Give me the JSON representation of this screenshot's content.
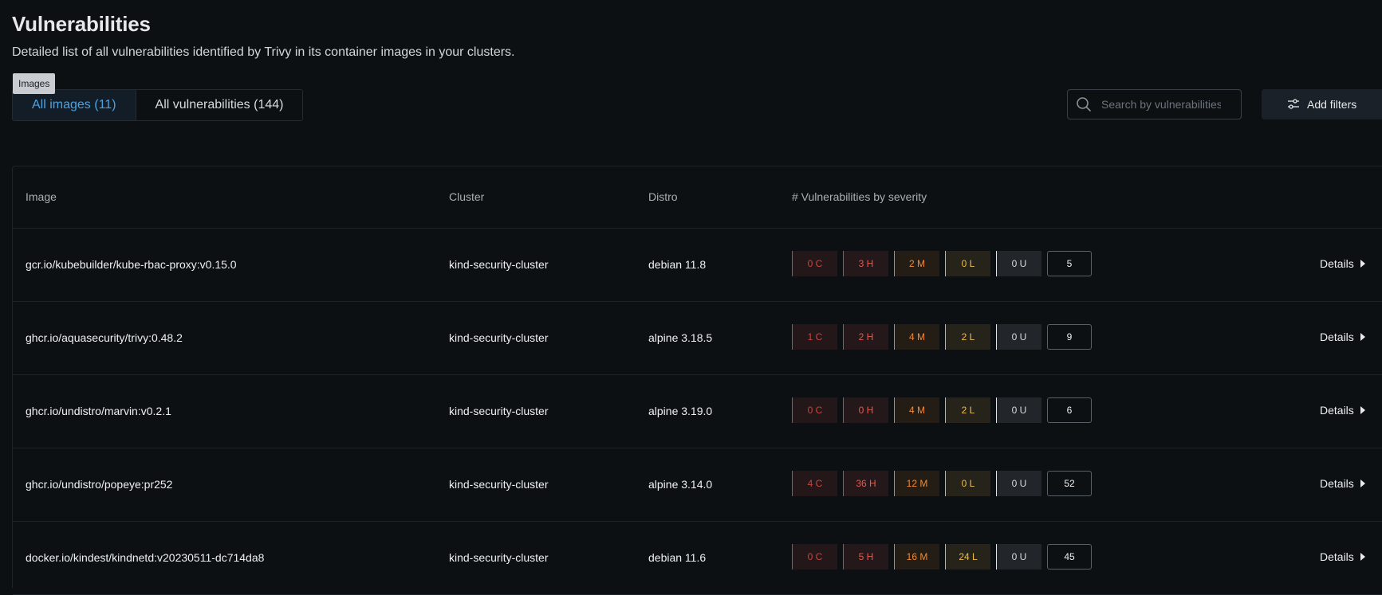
{
  "header": {
    "title": "Vulnerabilities",
    "subtitle": "Detailed list of all vulnerabilities identified by Trivy in its container images in your clusters."
  },
  "tooltip": {
    "text": "Images"
  },
  "tabs": [
    {
      "label": "All images (11)",
      "active": true
    },
    {
      "label": "All vulnerabilities (144)",
      "active": false
    }
  ],
  "search": {
    "placeholder": "Search by vulnerabilities",
    "value": ""
  },
  "filters": {
    "label": "Add filters"
  },
  "table": {
    "columns": [
      "Image",
      "Cluster",
      "Distro",
      "# Vulnerabilities by severity"
    ],
    "details_label": "Details",
    "rows": [
      {
        "image": "gcr.io/kubebuilder/kube-rbac-proxy:v0.15.0",
        "cluster": "kind-security-cluster",
        "distro": "debian 11.8",
        "critical": "0 C",
        "high": "3 H",
        "medium": "2 M",
        "low": "0 L",
        "unknown": "0 U",
        "total": "5"
      },
      {
        "image": "ghcr.io/aquasecurity/trivy:0.48.2",
        "cluster": "kind-security-cluster",
        "distro": "alpine 3.18.5",
        "critical": "1 C",
        "high": "2 H",
        "medium": "4 M",
        "low": "2 L",
        "unknown": "0 U",
        "total": "9"
      },
      {
        "image": "ghcr.io/undistro/marvin:v0.2.1",
        "cluster": "kind-security-cluster",
        "distro": "alpine 3.19.0",
        "critical": "0 C",
        "high": "0 H",
        "medium": "4 M",
        "low": "2 L",
        "unknown": "0 U",
        "total": "6"
      },
      {
        "image": "ghcr.io/undistro/popeye:pr252",
        "cluster": "kind-security-cluster",
        "distro": "alpine 3.14.0",
        "critical": "4 C",
        "high": "36 H",
        "medium": "12 M",
        "low": "0 L",
        "unknown": "0 U",
        "total": "52"
      },
      {
        "image": "docker.io/kindest/kindnetd:v20230511-dc714da8",
        "cluster": "kind-security-cluster",
        "distro": "debian 11.6",
        "critical": "0 C",
        "high": "5 H",
        "medium": "16 M",
        "low": "24 L",
        "unknown": "0 U",
        "total": "45"
      }
    ]
  },
  "colors": {
    "background": "#0d1013",
    "accent": "#4aa3e0",
    "critical": "#c9453d",
    "high": "#e45b4e",
    "medium": "#f08a35",
    "low": "#f2be4a"
  },
  "icons": {
    "search": "search-icon",
    "filters": "sliders-icon",
    "details": "caret-right-icon"
  }
}
